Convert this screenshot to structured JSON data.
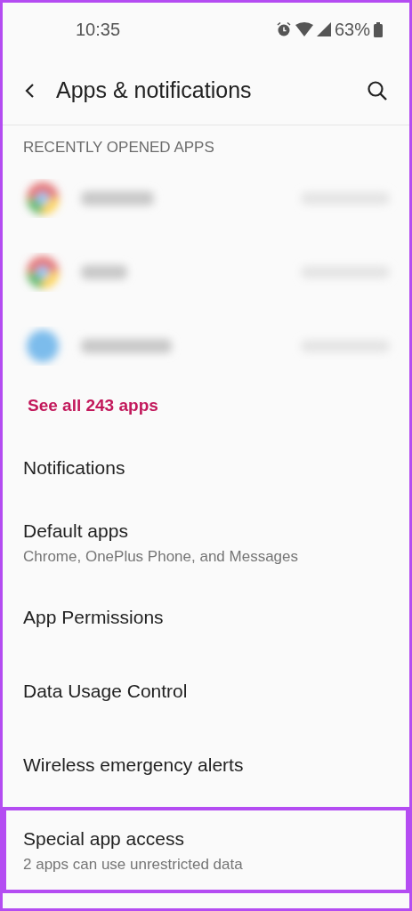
{
  "status_bar": {
    "time": "10:35",
    "battery": "63%"
  },
  "toolbar": {
    "title": "Apps & notifications"
  },
  "recent_section": {
    "header": "RECENTLY OPENED APPS",
    "blurred_apps": [
      {
        "kind": "multicolor"
      },
      {
        "kind": "multicolor"
      },
      {
        "kind": "solid",
        "color": "#7cbcec"
      }
    ],
    "see_all": "See all 243 apps"
  },
  "menu_items": [
    {
      "title": "Notifications",
      "highlighted": false
    },
    {
      "title": "Default apps",
      "subtitle": "Chrome, OnePlus Phone, and Messages",
      "highlighted": false
    },
    {
      "title": "App Permissions",
      "highlighted": false
    },
    {
      "title": "Data Usage Control",
      "highlighted": false
    },
    {
      "title": "Wireless emergency alerts",
      "highlighted": false
    },
    {
      "title": "Special app access",
      "subtitle": "2 apps can use unrestricted data",
      "highlighted": true
    }
  ]
}
